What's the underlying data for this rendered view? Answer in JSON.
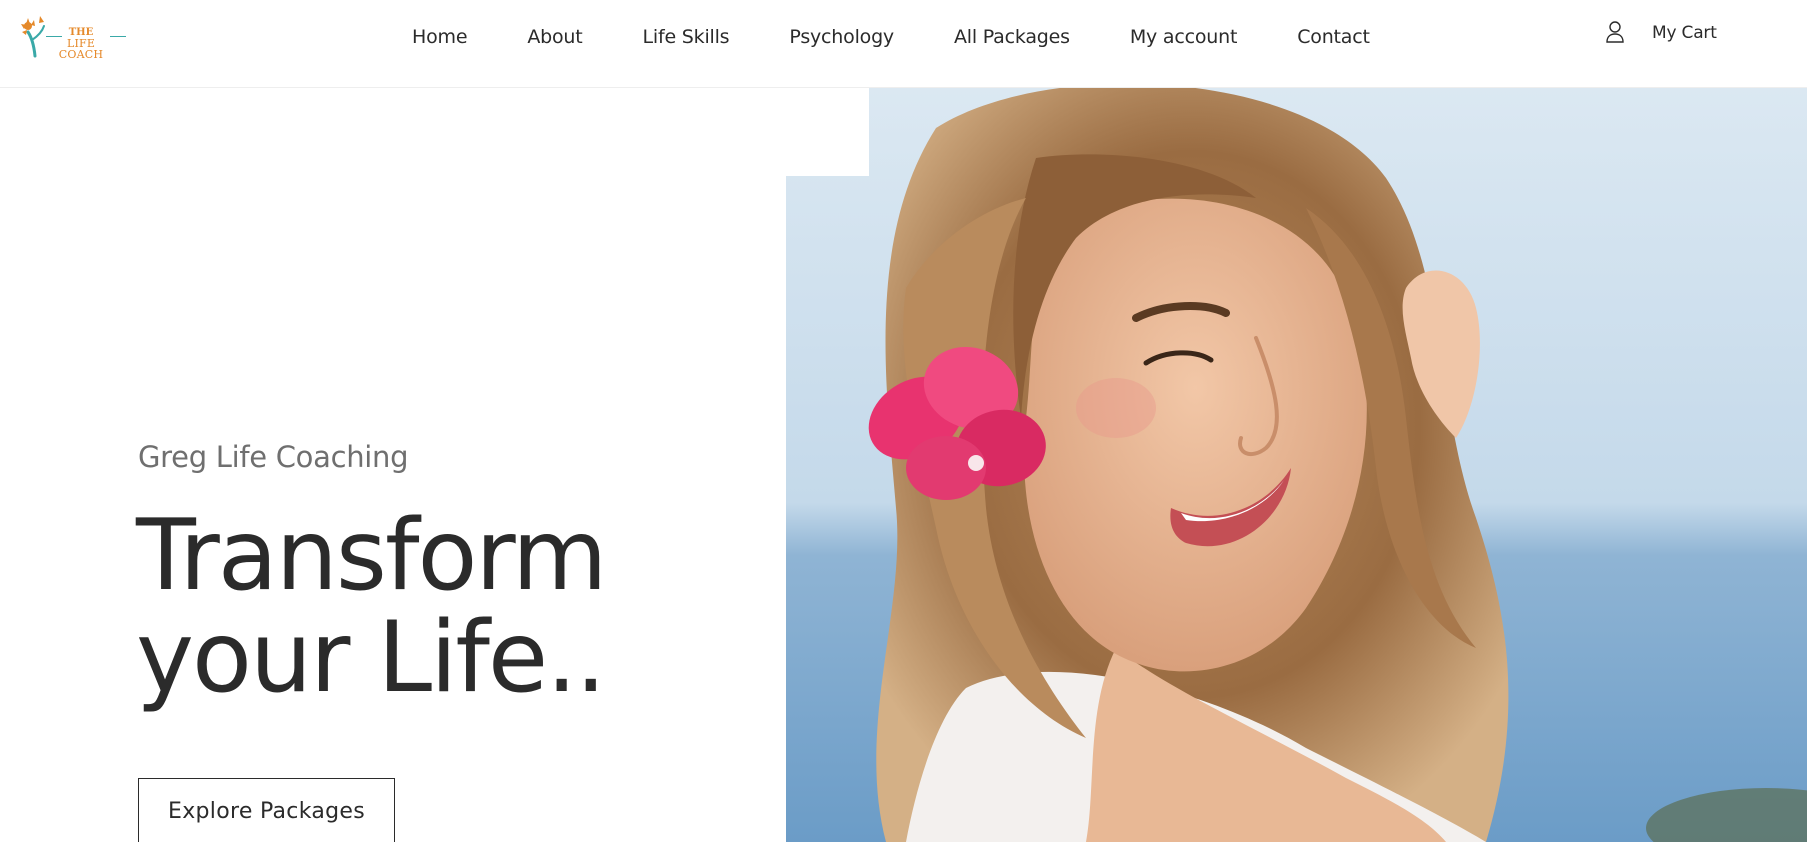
{
  "brand": {
    "logo_line1": "THE",
    "logo_line2": "LIFE COACH"
  },
  "nav": {
    "items": [
      {
        "label": "Home"
      },
      {
        "label": "About"
      },
      {
        "label": "Life Skills"
      },
      {
        "label": "Psychology"
      },
      {
        "label": "All Packages"
      },
      {
        "label": "My account"
      },
      {
        "label": "Contact"
      }
    ]
  },
  "header_right": {
    "account_icon": "user-icon",
    "cart_label": "My Cart"
  },
  "hero": {
    "subtitle": "Greg Life Coaching",
    "title_line1": "Transform",
    "title_line2": "your Life..",
    "cta_label": "Explore Packages",
    "image": "smiling-woman-with-pink-flower-photo"
  },
  "colors": {
    "text": "#2b2b2b",
    "muted": "#6f6f6f",
    "logo_orange": "#e5892a",
    "logo_teal": "#3aa9a8",
    "flower_pink": "#e8336f"
  }
}
